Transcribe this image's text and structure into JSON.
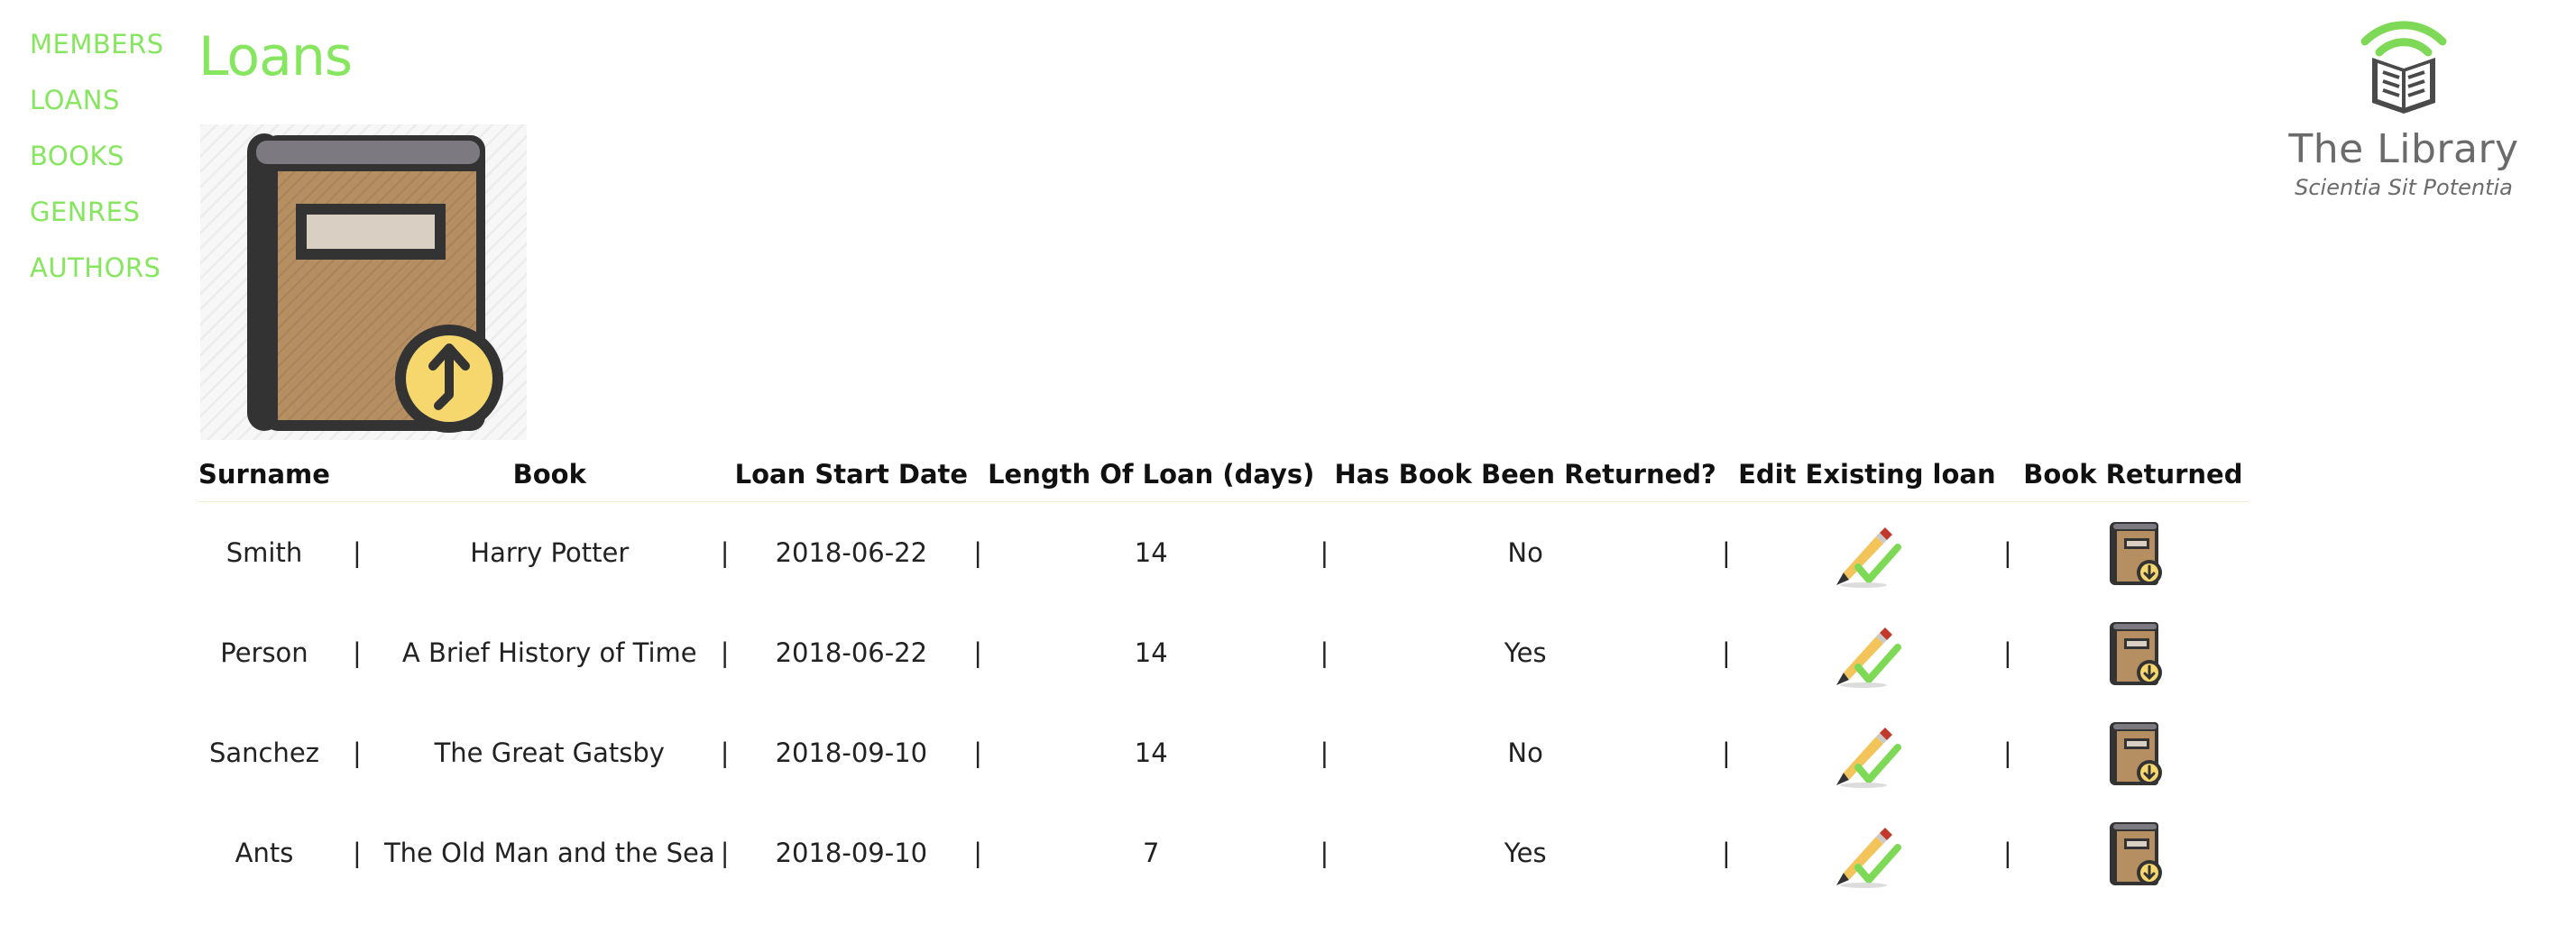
{
  "sidebar": {
    "items": [
      {
        "label": "MEMBERS"
      },
      {
        "label": "LOANS"
      },
      {
        "label": "BOOKS"
      },
      {
        "label": "GENRES"
      },
      {
        "label": "AUTHORS"
      }
    ]
  },
  "page": {
    "title": "Loans",
    "hero_icon": "book-loan-icon"
  },
  "logo": {
    "title": "The Library",
    "subtitle": "Scientia Sit Potentia",
    "icon": "wifi-book-logo-icon"
  },
  "table": {
    "headers": {
      "surname": "Surname",
      "book": "Book",
      "start": "Loan Start Date",
      "length": "Length Of Loan (days)",
      "returned": "Has Book Been Returned?",
      "edit": "Edit Existing loan",
      "book_returned": "Book Returned"
    },
    "separator": "|",
    "rows": [
      {
        "surname": "Smith",
        "book": "Harry Potter",
        "start": "2018-06-22",
        "length": "14",
        "returned": "No"
      },
      {
        "surname": "Person",
        "book": "A Brief History of Time",
        "start": "2018-06-22",
        "length": "14",
        "returned": "Yes"
      },
      {
        "surname": "Sanchez",
        "book": "The Great Gatsby",
        "start": "2018-09-10",
        "length": "14",
        "returned": "No"
      },
      {
        "surname": "Ants",
        "book": "The Old Man and the Sea",
        "start": "2018-09-10",
        "length": "7",
        "returned": "Yes"
      }
    ],
    "edit_icon": "pencil-check-icon",
    "return_icon": "book-return-icon"
  },
  "colors": {
    "accent": "#87e65f",
    "book_brown": "#b58f62",
    "book_dark": "#333333",
    "badge_yellow": "#f5d76e",
    "logo_green": "#7ed957",
    "logo_gray": "#6b6b6b"
  }
}
